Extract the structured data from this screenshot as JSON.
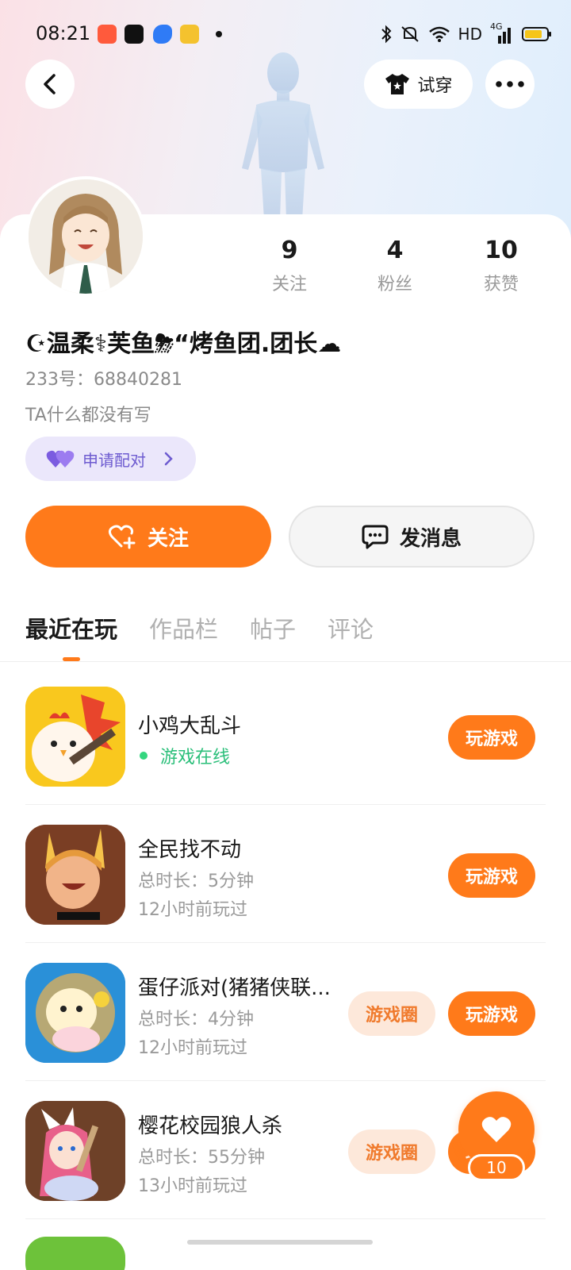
{
  "status_bar": {
    "time": "08:21",
    "network": "HD",
    "signal": "4G",
    "battery_fraction": 0.8,
    "app_icon_colors": [
      "#ff5a3c",
      "#111111",
      "#2f7bf6",
      "#f4c22e"
    ]
  },
  "header": {
    "try_on_label": "试穿"
  },
  "profile": {
    "username": "☪温柔⚕芙鱼⛈“烤鱼团.团长☁",
    "uid": "233号：68840281",
    "bio": "TA什么都没有写",
    "pair_label": "申请配对",
    "stats": [
      {
        "num": "9",
        "label": "关注"
      },
      {
        "num": "4",
        "label": "粉丝"
      },
      {
        "num": "10",
        "label": "获赞"
      }
    ]
  },
  "actions": {
    "follow_label": "关注",
    "message_label": "发消息"
  },
  "tabs": [
    "最近在玩",
    "作品栏",
    "帖子",
    "评论"
  ],
  "games": [
    {
      "title": "小鸡大乱斗",
      "status": "游戏在线",
      "play_label": "玩游戏"
    },
    {
      "title": "全民找不动",
      "duration": "总时长：5分钟",
      "last_played": "12小时前玩过",
      "play_label": "玩游戏"
    },
    {
      "title": "蛋仔派对(猪猪侠联...",
      "duration": "总时长：4分钟",
      "last_played": "12小时前玩过",
      "circle_label": "游戏圈",
      "play_label": "玩游戏"
    },
    {
      "title": "樱花校园狼人杀",
      "duration": "总时长：55分钟",
      "last_played": "13小时前玩过",
      "circle_label": "游戏圈",
      "play_label": "玩游戏"
    }
  ],
  "like_fab": {
    "count": "10"
  },
  "colors": {
    "accent": "#ff7a1a",
    "online_green": "#2bbf7a",
    "pair_purple": "#6d5bd0"
  }
}
